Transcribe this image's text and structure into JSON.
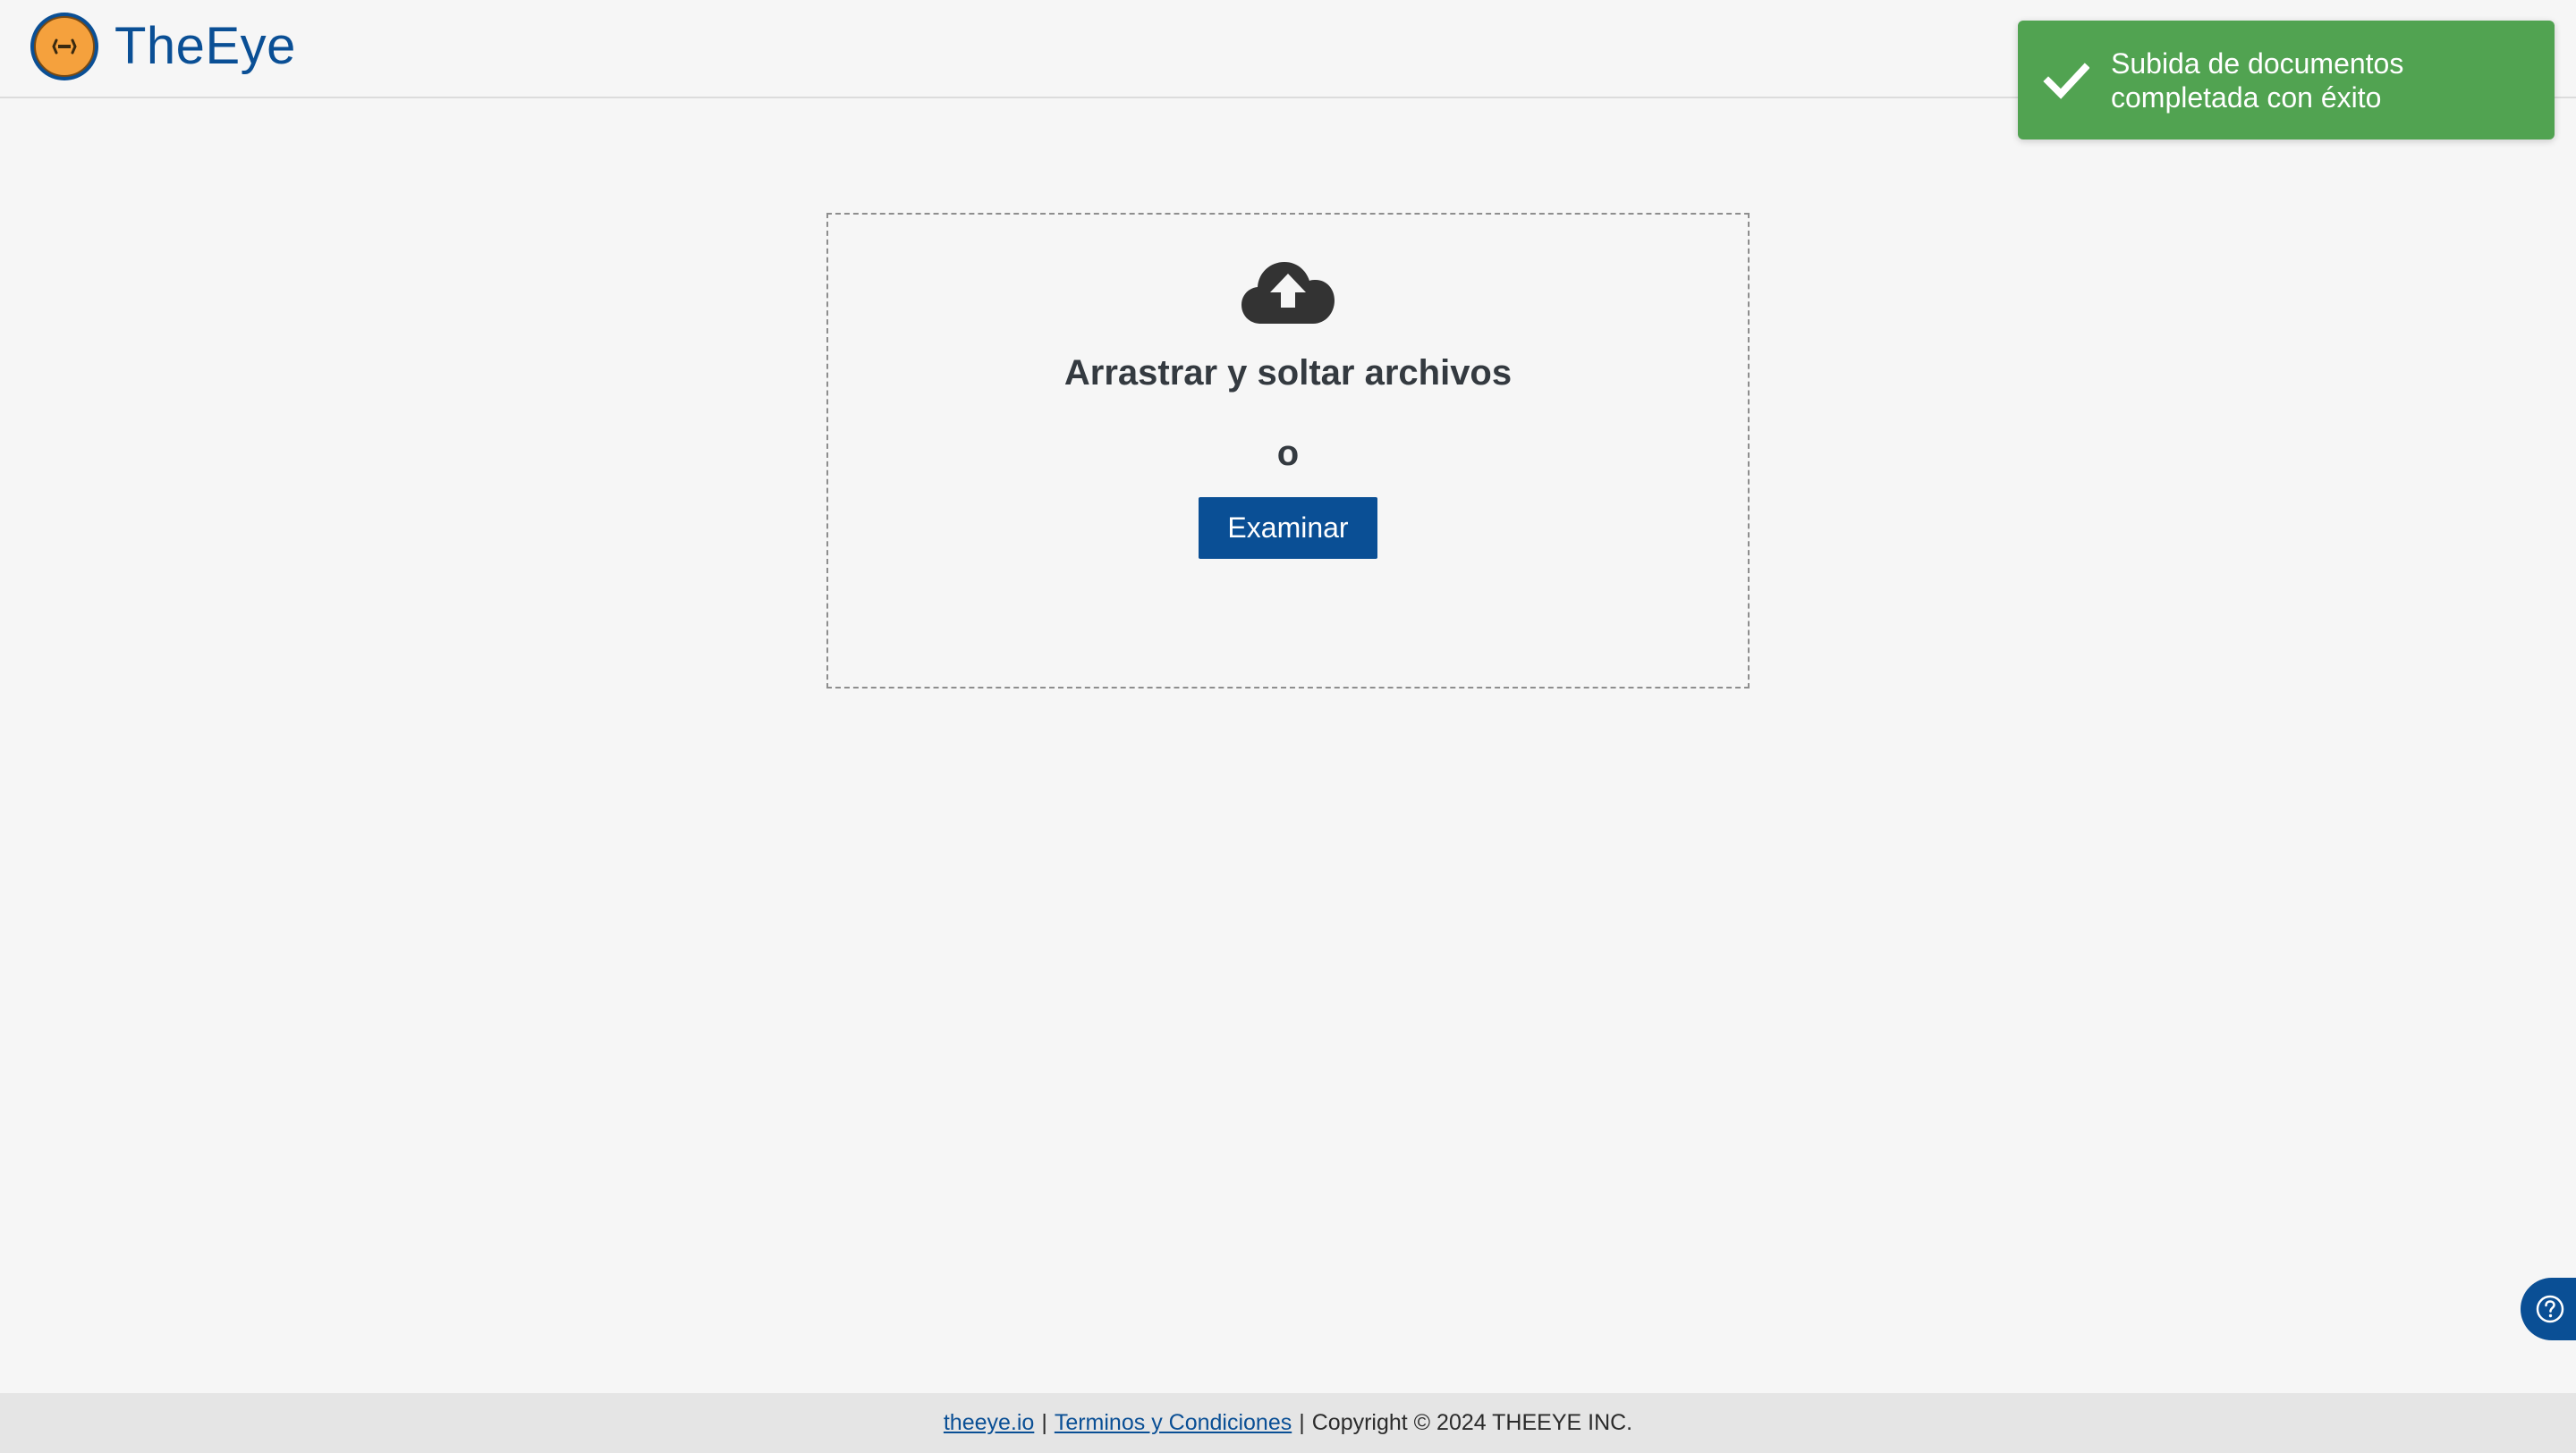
{
  "header": {
    "brand": "TheEye"
  },
  "toast": {
    "message": "Subida de documentos completada con éxito",
    "icon": "checkmark-icon",
    "color": "#51a351"
  },
  "dropzone": {
    "icon": "cloud-upload-icon",
    "title": "Arrastrar y soltar archivos",
    "or_text": "o",
    "browse_label": "Examinar"
  },
  "help": {
    "icon": "question-circle-icon"
  },
  "footer": {
    "link_site": "theeye.io",
    "separator": "|",
    "link_terms": "Terminos y Condiciones",
    "copyright": "Copyright © 2024 THEEYE INC."
  },
  "colors": {
    "brand_blue": "#0a4f95",
    "logo_orange": "#f5a13d",
    "background": "#f6f6f6"
  }
}
